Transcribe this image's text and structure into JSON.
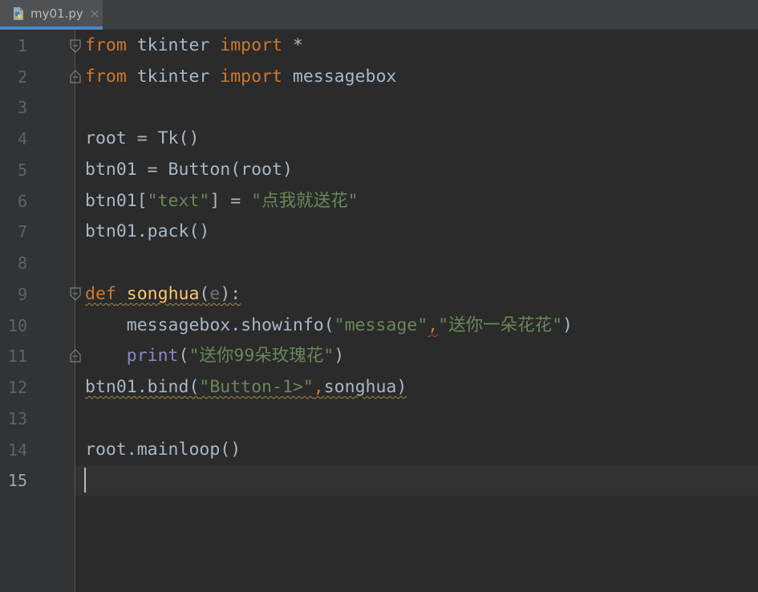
{
  "tab": {
    "filename": "my01.py",
    "close": "×",
    "icon": "python-file-icon"
  },
  "colors": {
    "keyword": "#cc7832",
    "string": "#6a8759",
    "function": "#ffc66d",
    "builtin": "#8888c6",
    "text": "#a9b7c6",
    "background": "#2b2b2b"
  },
  "current_line": 15,
  "lines": [
    {
      "n": "1",
      "tokens": [
        "from",
        " tkinter ",
        "import",
        " *"
      ]
    },
    {
      "n": "2",
      "tokens": [
        "from",
        " tkinter ",
        "import",
        " messagebox"
      ]
    },
    {
      "n": "3",
      "tokens": []
    },
    {
      "n": "4",
      "tokens": [
        "root = Tk()"
      ]
    },
    {
      "n": "5",
      "tokens": [
        "btn01 = Button(root)"
      ]
    },
    {
      "n": "6",
      "tokens": [
        "btn01[",
        "\"text\"",
        "] = ",
        "\"点我就送花\""
      ]
    },
    {
      "n": "7",
      "tokens": [
        "btn01.pack()"
      ]
    },
    {
      "n": "8",
      "tokens": []
    },
    {
      "n": "9",
      "tokens": [
        "def",
        " ",
        "songhua",
        "(",
        "e",
        "):"
      ]
    },
    {
      "n": "10",
      "tokens": [
        "    messagebox.showinfo(",
        "\"message\"",
        ",",
        "\"送你一朵花花\"",
        ")"
      ]
    },
    {
      "n": "11",
      "tokens": [
        "    ",
        "print",
        "(",
        "\"送你99朵玫瑰花\"",
        ")"
      ]
    },
    {
      "n": "12",
      "tokens": [
        "btn01.bind(",
        "\"Button-1>\"",
        ",",
        "songhua)"
      ]
    },
    {
      "n": "13",
      "tokens": []
    },
    {
      "n": "14",
      "tokens": [
        "root.mainloop()"
      ]
    },
    {
      "n": "15",
      "tokens": []
    }
  ]
}
